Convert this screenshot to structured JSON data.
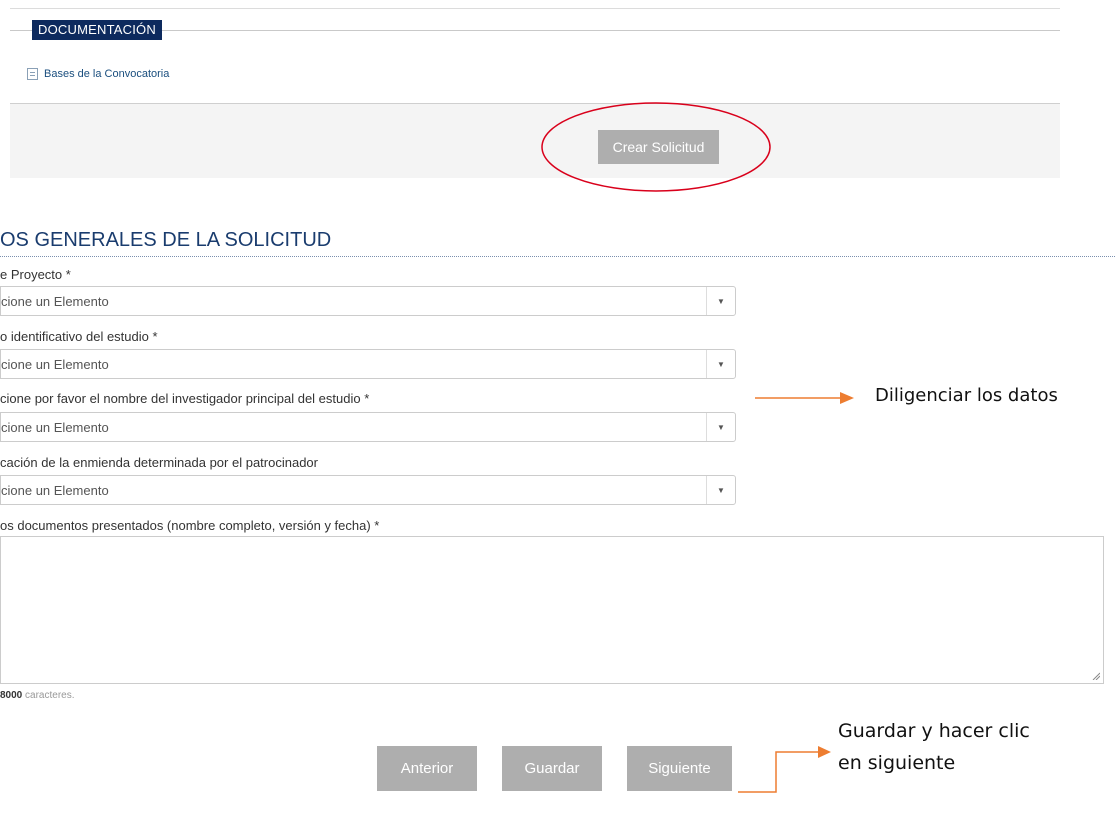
{
  "documentation": {
    "header": "DOCUMENTACIÓN",
    "link_label": "Bases de la Convocatoria",
    "create_button": "Crear Solicitud"
  },
  "form": {
    "title": "OS GENERALES DE LA SOLICITUD",
    "fields": [
      {
        "label": "e Proyecto *",
        "value": "cione un Elemento"
      },
      {
        "label": "o identificativo del estudio *",
        "value": "cione un Elemento"
      },
      {
        "label": "cione por favor el nombre del investigador principal del estudio *",
        "value": "cione un Elemento"
      },
      {
        "label": "cación de la enmienda determinada por el patrocinador",
        "value": "cione un Elemento"
      }
    ],
    "textarea_label": "os documentos presentados (nombre completo, versión y fecha) *",
    "char_limit": "8000",
    "char_suffix": "caracteres.",
    "buttons": {
      "prev": "Anterior",
      "save": "Guardar",
      "next": "Siguiente"
    }
  },
  "annotations": {
    "fill_data": "Diligenciar los datos",
    "save_next_line1": "Guardar y hacer clic",
    "save_next_line2": "en siguiente"
  },
  "colors": {
    "accent": "#0d2a5e",
    "arrow": "#ed7d31",
    "highlight": "#d9001b",
    "button": "#aeaeae"
  }
}
